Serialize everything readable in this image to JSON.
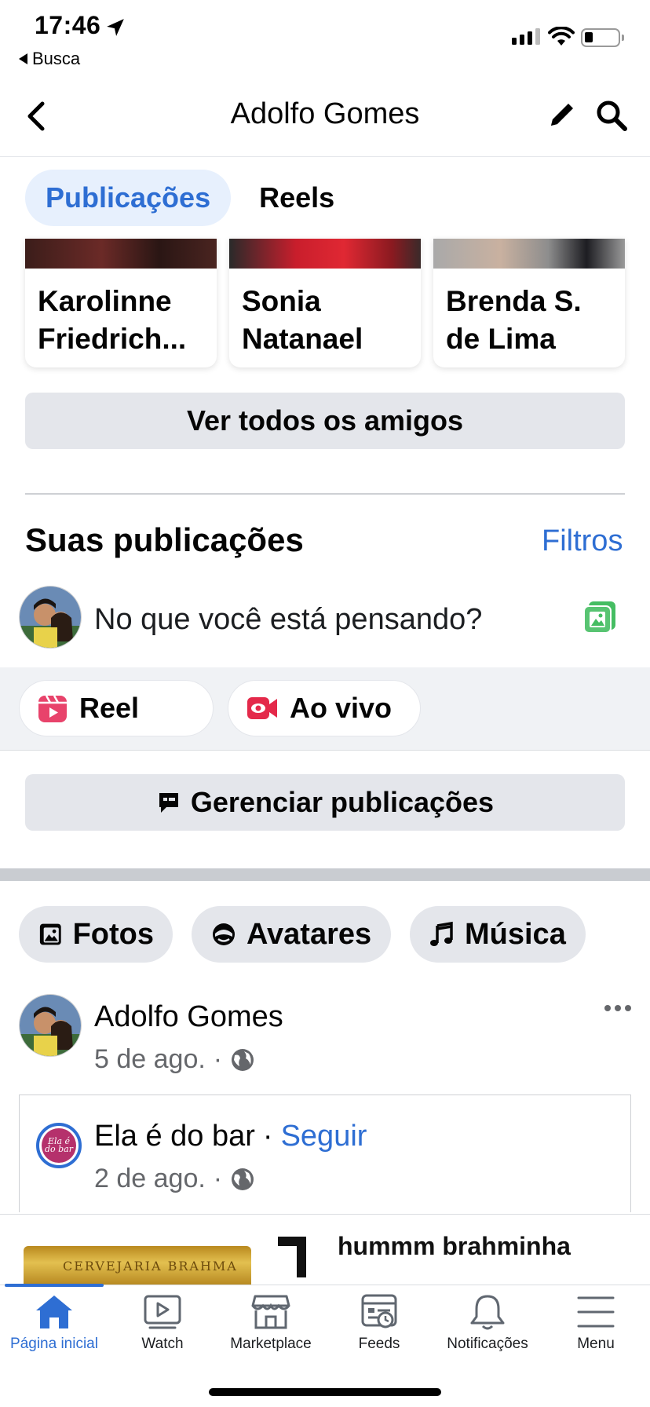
{
  "status_bar": {
    "time": "17:46",
    "back_app": "Busca"
  },
  "header": {
    "title": "Adolfo Gomes"
  },
  "tabs": [
    {
      "label": "Publicações",
      "active": true
    },
    {
      "label": "Reels",
      "active": false
    }
  ],
  "friends": [
    {
      "line1": "Karolinne",
      "line2": "Friedrich..."
    },
    {
      "line1": "Sonia",
      "line2": "Natanael"
    },
    {
      "line1": "Brenda S.",
      "line2": "de Lima"
    }
  ],
  "see_all_friends": "Ver todos os amigos",
  "posts_section": {
    "title": "Suas publicações",
    "filters": "Filtros"
  },
  "composer": {
    "placeholder": "No que você está pensando?"
  },
  "create_chips": [
    {
      "label": "Reel"
    },
    {
      "label": "Ao vivo"
    }
  ],
  "manage_posts": "Gerenciar publicações",
  "media_chips": [
    {
      "label": "Fotos"
    },
    {
      "label": "Avatares"
    },
    {
      "label": "Música"
    }
  ],
  "post": {
    "author": "Adolfo Gomes",
    "date": "5 de ago.",
    "separator": "·",
    "shared": {
      "page_name": "Ela é do bar",
      "separator": "·",
      "follow": "Seguir",
      "date": "2 de ago.",
      "page_logo_text": "Ela é do bar",
      "preview_text": "hummm brahminha",
      "can_text": "CERVEJARIA BRAHMA"
    }
  },
  "bottom_nav": [
    {
      "label": "Página inicial",
      "icon": "home-icon",
      "active": true
    },
    {
      "label": "Watch",
      "icon": "watch-icon",
      "active": false
    },
    {
      "label": "Marketplace",
      "icon": "marketplace-icon",
      "active": false
    },
    {
      "label": "Feeds",
      "icon": "feeds-icon",
      "active": false
    },
    {
      "label": "Notificações",
      "icon": "bell-icon",
      "active": false
    },
    {
      "label": "Menu",
      "icon": "menu-icon",
      "active": false
    }
  ],
  "colors": {
    "accent": "#2e6ed3",
    "tab_active_bg": "#e7f0fd",
    "button_grey": "#e4e6eb",
    "secondary_text": "#65676b",
    "reel_red": "#e8436b",
    "live_red": "#e4294a",
    "photo_green": "#45bd62"
  }
}
